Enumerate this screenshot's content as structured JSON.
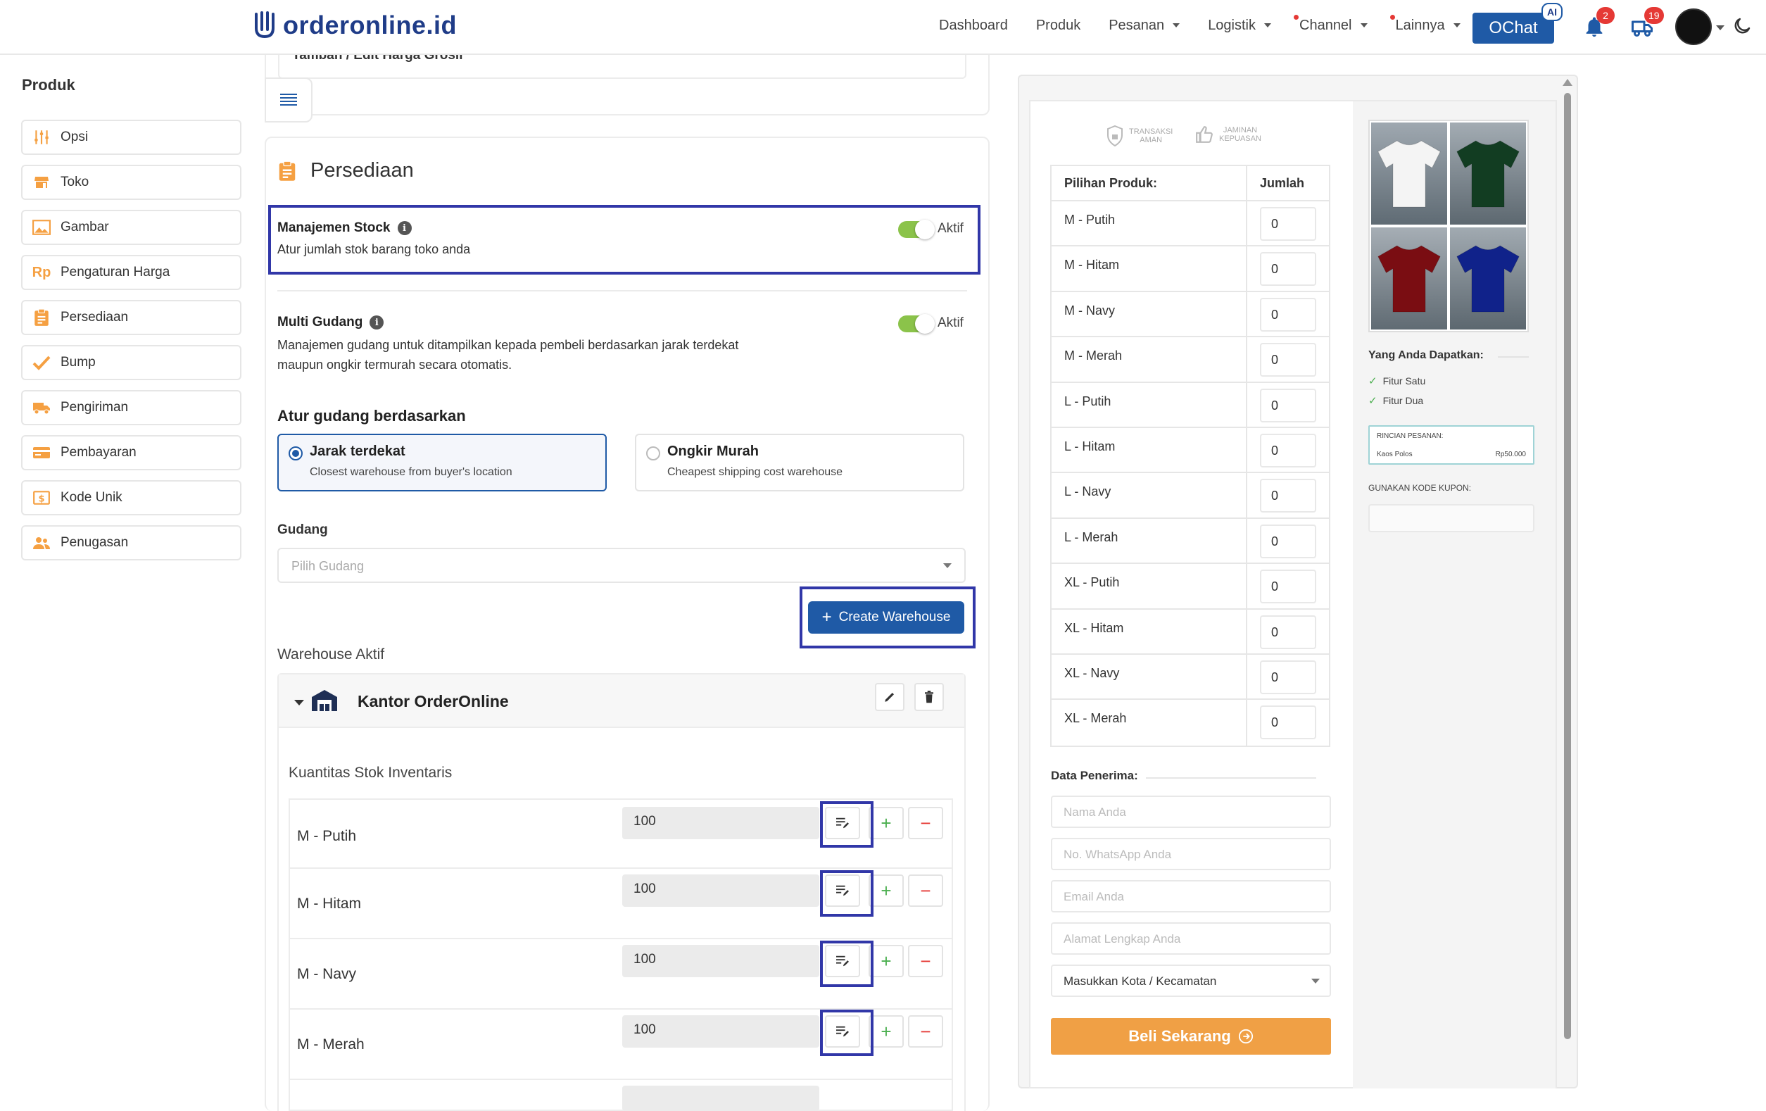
{
  "brand": {
    "name": "orderonline.id",
    "color": "#1f3c88"
  },
  "nav": {
    "items": [
      {
        "label": "Dashboard",
        "dropdown": false,
        "dot": false
      },
      {
        "label": "Produk",
        "dropdown": false,
        "dot": false
      },
      {
        "label": "Pesanan",
        "dropdown": true,
        "dot": false
      },
      {
        "label": "Logistik",
        "dropdown": true,
        "dot": false
      },
      {
        "label": "Channel",
        "dropdown": true,
        "dot": true
      },
      {
        "label": "Lainnya",
        "dropdown": true,
        "dot": true
      }
    ],
    "ochat_label": "OChat",
    "ai_badge": "AI",
    "notif_count": "2",
    "shipping_count": "19"
  },
  "sidebar": {
    "title": "Produk",
    "items": [
      {
        "label": "Opsi",
        "icon": "sliders-icon"
      },
      {
        "label": "Toko",
        "icon": "store-icon"
      },
      {
        "label": "Gambar",
        "icon": "image-icon"
      },
      {
        "label": "Pengaturan Harga",
        "icon": "rupiah-icon"
      },
      {
        "label": "Persediaan",
        "icon": "clipboard-icon"
      },
      {
        "label": "Bump",
        "icon": "check-icon"
      },
      {
        "label": "Pengiriman",
        "icon": "truck-icon"
      },
      {
        "label": "Pembayaran",
        "icon": "card-icon"
      },
      {
        "label": "Kode Unik",
        "icon": "code-icon"
      },
      {
        "label": "Penugasan",
        "icon": "users-icon"
      }
    ]
  },
  "top_card": {
    "label": "Tambah / Edit Harga Grosir"
  },
  "persediaan": {
    "title": "Persediaan",
    "stock": {
      "title": "Manajemen Stock",
      "desc": "Atur jumlah stok barang toko anda",
      "toggle_label": "Aktif"
    },
    "multi_gudang": {
      "title": "Multi Gudang",
      "desc_line1": "Manajemen gudang untuk ditampilkan kepada pembeli berdasarkan jarak terdekat",
      "desc_line2": "maupun ongkir termurah secara otomatis.",
      "toggle_label": "Aktif"
    },
    "atur_title": "Atur gudang berdasarkan",
    "options": [
      {
        "title": "Jarak terdekat",
        "sub": "Closest warehouse from buyer's location",
        "selected": true
      },
      {
        "title": "Ongkir Murah",
        "sub": "Cheapest shipping cost warehouse",
        "selected": false
      }
    ],
    "gudang_label": "Gudang",
    "gudang_placeholder": "Pilih Gudang",
    "create_label": "Create Warehouse",
    "active_label": "Warehouse Aktif",
    "warehouse_name": "Kantor OrderOnline",
    "kuantitas_label": "Kuantitas Stok Inventaris",
    "stock_rows": [
      {
        "name": "M - Putih",
        "qty": "100"
      },
      {
        "name": "M - Hitam",
        "qty": "100"
      },
      {
        "name": "M - Navy",
        "qty": "100"
      },
      {
        "name": "M - Merah",
        "qty": "100"
      }
    ]
  },
  "preview": {
    "trust": [
      {
        "line1": "TRANSAKSI",
        "line2": "AMAN"
      },
      {
        "line1": "JAMINAN",
        "line2": "KEPUASAN"
      }
    ],
    "table_head": {
      "col1": "Pilihan Produk:",
      "col2": "Jumlah"
    },
    "products": [
      {
        "name": "M - Putih",
        "qty": "0"
      },
      {
        "name": "M - Hitam",
        "qty": "0"
      },
      {
        "name": "M - Navy",
        "qty": "0"
      },
      {
        "name": "M - Merah",
        "qty": "0"
      },
      {
        "name": "L - Putih",
        "qty": "0"
      },
      {
        "name": "L - Hitam",
        "qty": "0"
      },
      {
        "name": "L - Navy",
        "qty": "0"
      },
      {
        "name": "L - Merah",
        "qty": "0"
      },
      {
        "name": "XL - Putih",
        "qty": "0"
      },
      {
        "name": "XL - Hitam",
        "qty": "0"
      },
      {
        "name": "XL - Navy",
        "qty": "0"
      },
      {
        "name": "XL - Merah",
        "qty": "0"
      }
    ],
    "data_penerima_label": "Data Penerima:",
    "fields": {
      "name_ph": "Nama Anda",
      "wa_ph": "No. WhatsApp Anda",
      "email_ph": "Email Anda",
      "address_ph": "Alamat Lengkap Anda",
      "city_value": "Masukkan Kota / Kecamatan"
    },
    "buy_label": "Beli Sekarang",
    "shirt_colors": [
      "#f4f4f4",
      "#123d22",
      "#7a0d12",
      "#10228a"
    ],
    "yang_anda_label": "Yang Anda Dapatkan:",
    "features": [
      "Fitur Satu",
      "Fitur Dua"
    ],
    "rincian": {
      "title": "RINCIAN PESANAN:",
      "item": "Kaos Polos",
      "price": "Rp50.000"
    },
    "kupon_label": "GUNAKAN KODE KUPON:"
  }
}
